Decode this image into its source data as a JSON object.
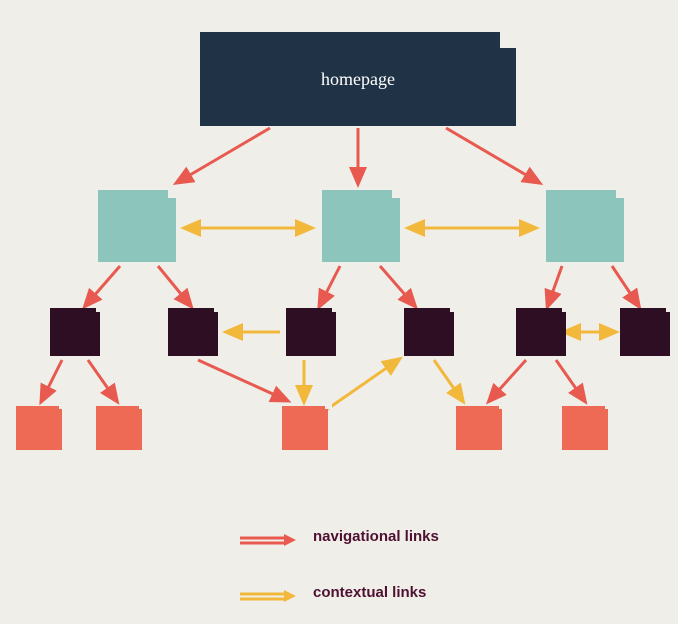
{
  "diagram": {
    "root_label": "homepage",
    "legend": {
      "navigational": "navigational links",
      "contextual": "contextual links"
    },
    "colors": {
      "root": "#1f3246",
      "level1": "#8bc5bb",
      "level2": "#2d0e23",
      "level3": "#ef6a55",
      "nav_arrow": "#e85a4f",
      "ctx_arrow": "#f2b83b",
      "bg": "#f0eee9"
    },
    "hierarchy": {
      "root": "homepage",
      "level1_count": 3,
      "level2_count": 6,
      "level3_count": 5
    },
    "nav_links": [
      [
        "root",
        "L1-1"
      ],
      [
        "root",
        "L1-2"
      ],
      [
        "root",
        "L1-3"
      ],
      [
        "L1-1",
        "L2-1"
      ],
      [
        "L1-1",
        "L2-2"
      ],
      [
        "L1-2",
        "L2-3"
      ],
      [
        "L1-2",
        "L2-4"
      ],
      [
        "L1-3",
        "L2-5"
      ],
      [
        "L1-3",
        "L2-6"
      ],
      [
        "L2-1",
        "L3-1"
      ],
      [
        "L2-1",
        "L3-2"
      ],
      [
        "L2-2",
        "L3-3"
      ],
      [
        "L2-5",
        "L3-4"
      ],
      [
        "L2-5",
        "L3-5"
      ]
    ],
    "ctx_links": [
      [
        "L1-1",
        "L1-2",
        "both"
      ],
      [
        "L1-2",
        "L1-3",
        "both"
      ],
      [
        "L2-3",
        "L2-2",
        "one"
      ],
      [
        "L2-5",
        "L2-6",
        "both"
      ],
      [
        "L2-3",
        "L3-3",
        "one"
      ],
      [
        "L3-3",
        "L2-4",
        "one"
      ],
      [
        "L2-4",
        "L3-4",
        "one"
      ]
    ]
  }
}
